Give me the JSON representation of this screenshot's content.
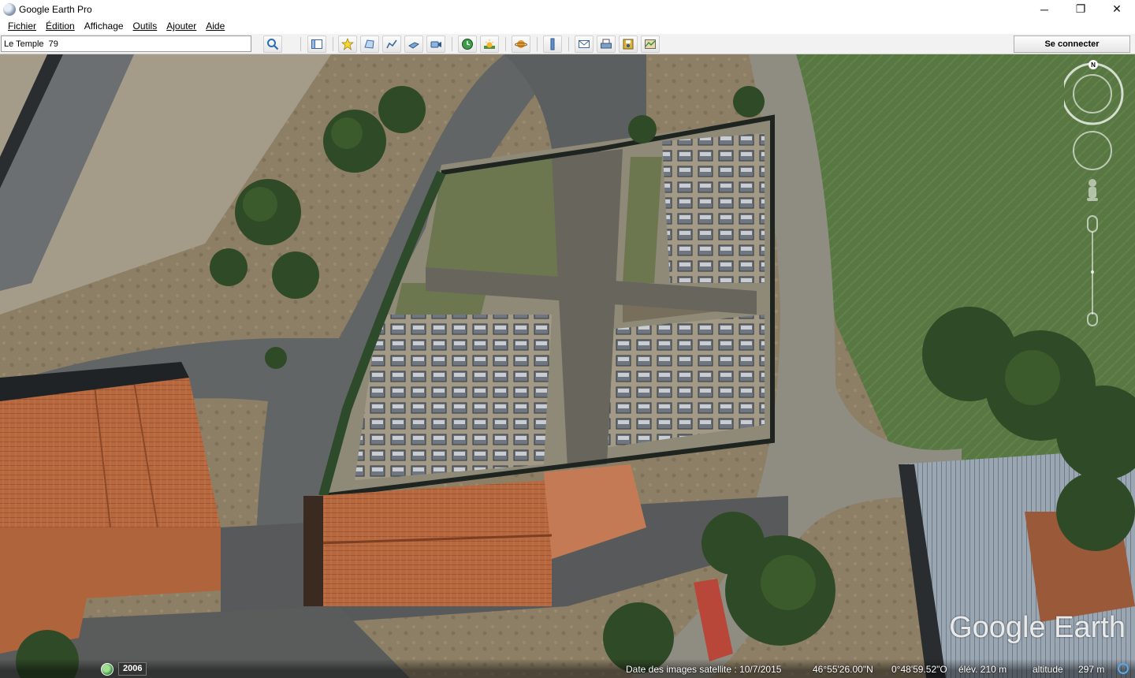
{
  "window": {
    "title": "Google Earth Pro",
    "controls": {
      "minimize": "─",
      "restore": "❐",
      "close": "✕"
    }
  },
  "menu": [
    {
      "label": "Fichier"
    },
    {
      "label": "Édition"
    },
    {
      "label": "Affichage"
    },
    {
      "label": "Outils"
    },
    {
      "label": "Ajouter"
    },
    {
      "label": "Aide"
    }
  ],
  "toolbar": {
    "search_value": "Le Temple  79",
    "buttons": [
      "search-icon",
      "sidebar-toggle-icon",
      "placemark-icon",
      "polygon-icon",
      "path-icon",
      "image-overlay-icon",
      "record-tour-icon",
      "historical-imagery-icon",
      "sunlight-icon",
      "planets-icon",
      "ruler-icon",
      "email-icon",
      "print-icon",
      "save-image-icon",
      "view-in-maps-icon"
    ],
    "connect_label": "Se connecter"
  },
  "map": {
    "compass_north": "N",
    "watermark": "Google Earth",
    "imagery_year": "2006"
  },
  "status": {
    "imagery_date_label": "Date des images satellite : 10/7/2015",
    "lat": "46°55'26.00\"N",
    "lon": "0°48'59.52\"O",
    "elevation": "élév.  210 m",
    "altitude_label": "altitude",
    "altitude": "297 m"
  },
  "colors": {
    "toolbar_bg": "#f2f2f2",
    "roof_tile": "#b9693f",
    "grass_field": "#5e7a45",
    "road_gray": "#5b5d5c",
    "wall_dark": "#1e2420"
  }
}
